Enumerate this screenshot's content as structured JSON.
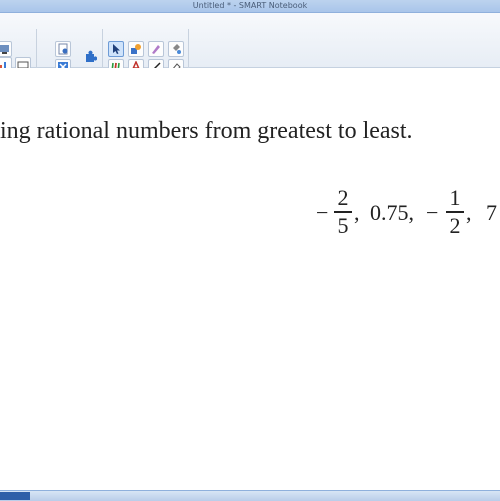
{
  "window": {
    "title": "Untitled * - SMART Notebook"
  },
  "toolbar": {
    "icons": [
      "screen-capture-icon",
      "chart-icon",
      "document-camera-icon",
      "new-page-icon",
      "properties-icon",
      "close-box-icon",
      "puzzle-icon",
      "select-icon",
      "pens-icon",
      "highlighter-icon",
      "eraser-icon",
      "text-icon",
      "line-icon",
      "shapes-icon",
      "fill-icon"
    ]
  },
  "content": {
    "instruction": "ing rational numbers from greatest to least.",
    "expression": {
      "frac1": {
        "sign": "−",
        "num": "2",
        "den": "5"
      },
      "sep1": ",",
      "decimal": "0.75,",
      "frac2": {
        "sign": "−",
        "num": "1",
        "den": "2"
      },
      "sep2": ",",
      "last": "7"
    }
  }
}
